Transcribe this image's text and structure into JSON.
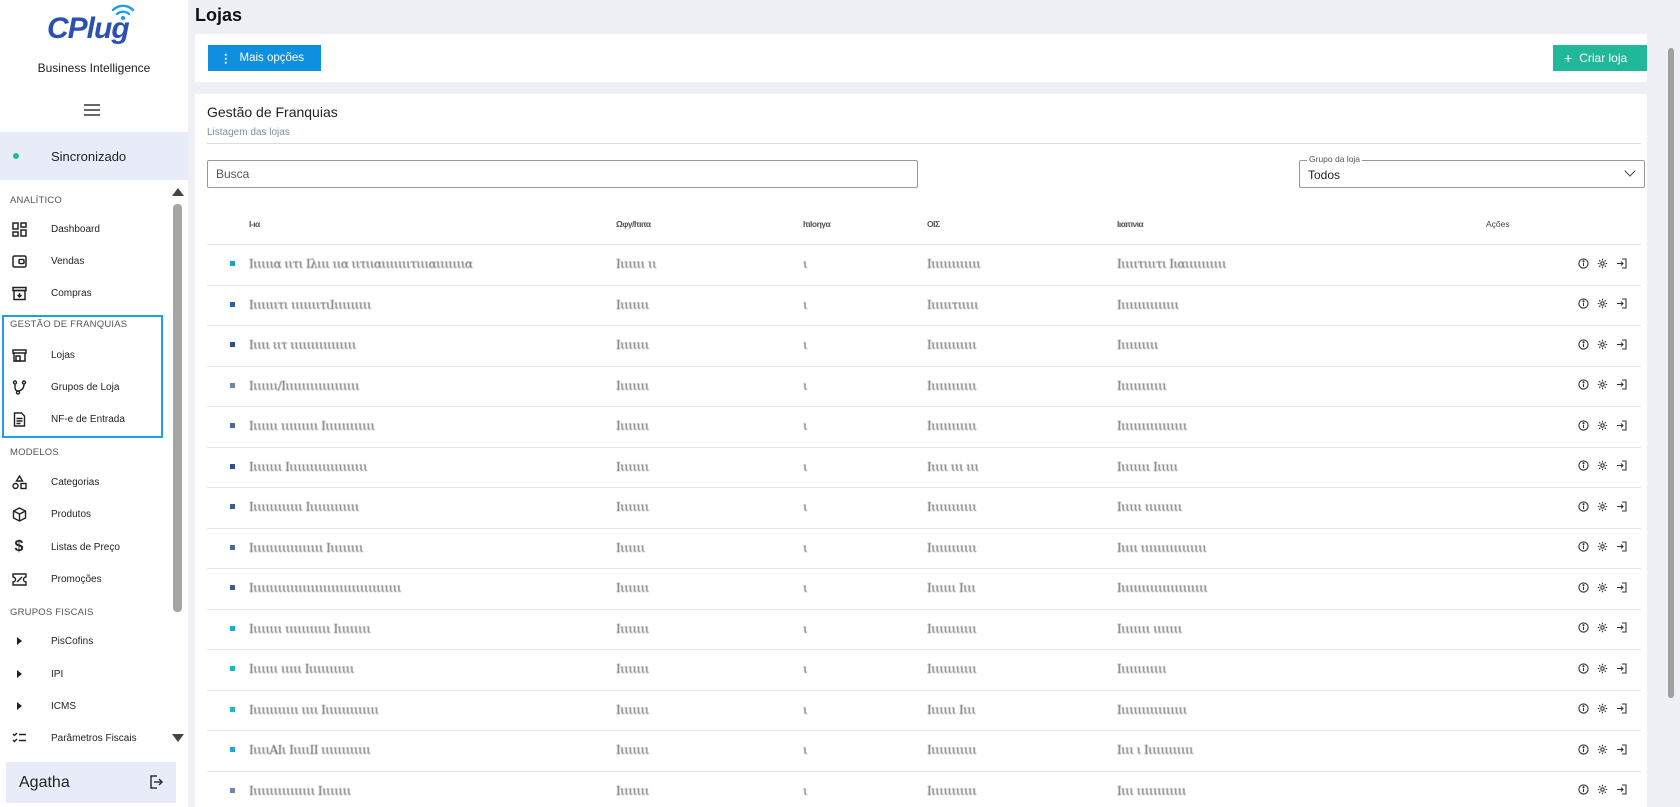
{
  "app": {
    "logo_text": "CPlug",
    "subtitle": "Business Intelligence"
  },
  "sidebar": {
    "sync_label": "Sincronizado",
    "sections": [
      {
        "label": "ANALÍTICO"
      },
      {
        "label": "GESTÃO DE FRANQUIAS"
      },
      {
        "label": "MODELOS"
      },
      {
        "label": "GRUPOS FISCAIS"
      }
    ],
    "items": [
      {
        "label": "Dashboard",
        "icon": "dashboard-icon"
      },
      {
        "label": "Vendas",
        "icon": "wallet-icon"
      },
      {
        "label": "Compras",
        "icon": "archive-icon"
      },
      {
        "label": "Lojas",
        "icon": "store-icon"
      },
      {
        "label": "Grupos de Loja",
        "icon": "branch-icon"
      },
      {
        "label": "NF-e de Entrada",
        "icon": "document-icon"
      },
      {
        "label": "Categorias",
        "icon": "shapes-icon"
      },
      {
        "label": "Produtos",
        "icon": "box-icon"
      },
      {
        "label": "Listas de Preço",
        "icon": "dollar-icon"
      },
      {
        "label": "Promoções",
        "icon": "ticket-icon"
      },
      {
        "label": "PisCofins",
        "icon": "caret-right-icon"
      },
      {
        "label": "IPI",
        "icon": "caret-right-icon"
      },
      {
        "label": "ICMS",
        "icon": "caret-right-icon"
      },
      {
        "label": "Parâmetros Fiscais",
        "icon": "checklist-icon"
      }
    ],
    "user_name": "Agatha"
  },
  "page": {
    "title": "Lojas",
    "more_options_label": "Mais opções",
    "create_label": "Criar loja"
  },
  "card": {
    "title": "Gestão de Franquias",
    "subtitle": "Listagem das lojas",
    "search_placeholder": "Busca",
    "group_filter_label": "Grupo da loja",
    "group_filter_value": "Todos"
  },
  "table": {
    "headers": [
      "Ι-ια",
      "Ωφγ/Ιτιιτα",
      "Ιτιlοηγα",
      "ΟΙΣ",
      "Ιιαιτινια",
      "Ações"
    ],
    "rows": [
      {
        "c1": "Ιιιιιια ιιτι Ιλιιι ιια ιιτιιαιιιιιιιτιιιαιιιιιιια",
        "c2": "Ιιιιιιι ιι",
        "c3": "ι",
        "c4": "Ιιιιιιιιιιιιι",
        "c5": "Ιιιιιτιιιτι Ιιαιιιιιιιιιι",
        "dot": "#1f9bd0"
      },
      {
        "c1": "Ιιιιιιιτι  ιιιιιιιτιΙιιιιιιιιι",
        "c2": "Ιιιιιιιι",
        "c3": "ι",
        "c4": "Ιιιιιιτιιιιι",
        "c5": "Ιιιιιιιιιιιιιιι",
        "dot": "#2b5fa8"
      },
      {
        "c1": "Ιιιιι ιιτ ιιιιιιιιιιιιιιιι",
        "c2": "Ιιιιιιιι",
        "c3": "ι",
        "c4": "Ιιιιιιιιιιιι",
        "c5": "Ιιιιιιιιιι",
        "dot": "#2b4f90"
      },
      {
        "c1": "Ιιιιιιι/Ιιιιιιιιιιιιιιιιιιι",
        "c2": "Ιιιιιιιι",
        "c3": "ι",
        "c4": "Ιιιιιιιιιιιι",
        "c5": "Ιιιιιιιιιιιι",
        "dot": "#6e86b0"
      },
      {
        "c1": "Ιιιιιιι ιιιιιιιιι Ιιιιιιιιιιιιι",
        "c2": "Ιιιιιιιι",
        "c3": "ι",
        "c4": "Ιιιιιιιιιιιι",
        "c5": "Ιιιιιιιιιιιιιιιιι",
        "dot": "#4a68a0"
      },
      {
        "c1": "Ιιιιιιιι Ιιιιιιιιιιιιιιιιιιιι",
        "c2": "Ιιιιιιιι",
        "c3": "ι",
        "c4": "Ιιιιι ιιι ιιι",
        "c5": "Ιιιιιιιι Ιιιιιι",
        "dot": "#2b4f90"
      },
      {
        "c1": "Ιιιιιιιιιιιιι    Ιιιιιιιιιιιιι",
        "c2": "Ιιιιιιιι",
        "c3": "ι",
        "c4": "Ιιιιιιιιιιιι",
        "c5": "Ιιιιιι ιιιιιιιιι",
        "dot": "#3b5a98"
      },
      {
        "c1": "Ιιιιιιιιιιιιιιιιιι Ιιιιιιιιι",
        "c2": "Ιιιιιιι",
        "c3": "ι",
        "c4": "Ιιιιιιιιιιιι",
        "c5": "Ιιιιι ιιιιιιιιιιιιιιιι",
        "dot": "#4a68a0"
      },
      {
        "c1": "Ιιιιιιιιιιιιιιιιιιιιιιιιιιιιιιιιιιιιι",
        "c2": "Ιιιιιιιι",
        "c3": "ι",
        "c4": "Ιιιιιιι Ιιιι",
        "c5": "Ιιιιιιιιιιιιιιιιιιιιιι",
        "dot": "#3b5a98"
      },
      {
        "c1": "Ιιιιιιιι ιιιιιιιιιιι  Ιιιιιιιιι",
        "c2": "Ιιιιιιιι",
        "c3": "ι",
        "c4": "Ιιιιιιιιιιιι",
        "c5": "Ιιιιιιιι ιιιιιιι",
        "dot": "#1fa8d6"
      },
      {
        "c1": "Ιιιιιιι ιιιιι Ιιιιιιιιιιιι",
        "c2": "Ιιιιιιιι",
        "c3": "ι",
        "c4": "Ιιιιιιιιιιιι",
        "c5": "Ιιιιιιιιιιιι",
        "dot": "#1fb6c8"
      },
      {
        "c1": "Ιιιιιιιιιιιι ιιιι Ιιιιιιιιιιιιιι",
        "c2": "Ιιιιιιιι",
        "c3": "ι",
        "c4": "Ιιιιιιι Ιιιι",
        "c5": "Ιιιιιιιιιιιιιιιιι",
        "dot": "#1fb6c8"
      },
      {
        "c1": "ΙιιιιΑΙι   ΙιιιιΙΙ ιιιιιιιιιιιι",
        "c2": "Ιιιιιιιι",
        "c3": "ι",
        "c4": "Ιιιιιιιιιιιι",
        "c5": "Ιιιι ι Ιιιιιιιιιιιι",
        "dot": "#1fa8d6"
      },
      {
        "c1": "Ιιιιιιιιιιιιιιιι Ιιιιιιιι",
        "c2": "Ιιιιιιιι",
        "c3": "ι",
        "c4": "Ιιιιιιιιιιιι",
        "c5": "Ιιιι ιιιιιιιιιιιι",
        "dot": "#6e86b0"
      }
    ]
  },
  "colors": {
    "primary": "#0f8fe0",
    "success": "#20b898",
    "highlight": "#1e9fe6",
    "sync_dot": "#20c08a"
  }
}
